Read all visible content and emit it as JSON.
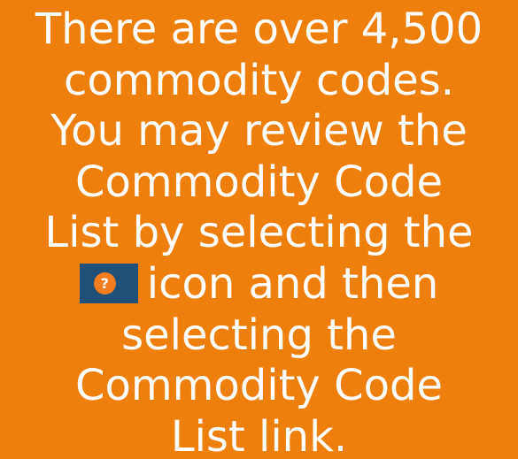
{
  "tooltip": {
    "background_color": "#ee7f0c",
    "text_color": "#ffffff",
    "lines": [
      "There are over 4,500",
      "commodity codes.",
      "You may review the",
      "Commodity Code",
      "List by selecting the",
      "icon and then",
      "selecting the",
      "Commodity Code",
      "List link."
    ],
    "help_icon": {
      "name": "help-question-icon",
      "glyph": "?",
      "box_color": "#1f5078",
      "circle_color": "#f47d20"
    }
  }
}
